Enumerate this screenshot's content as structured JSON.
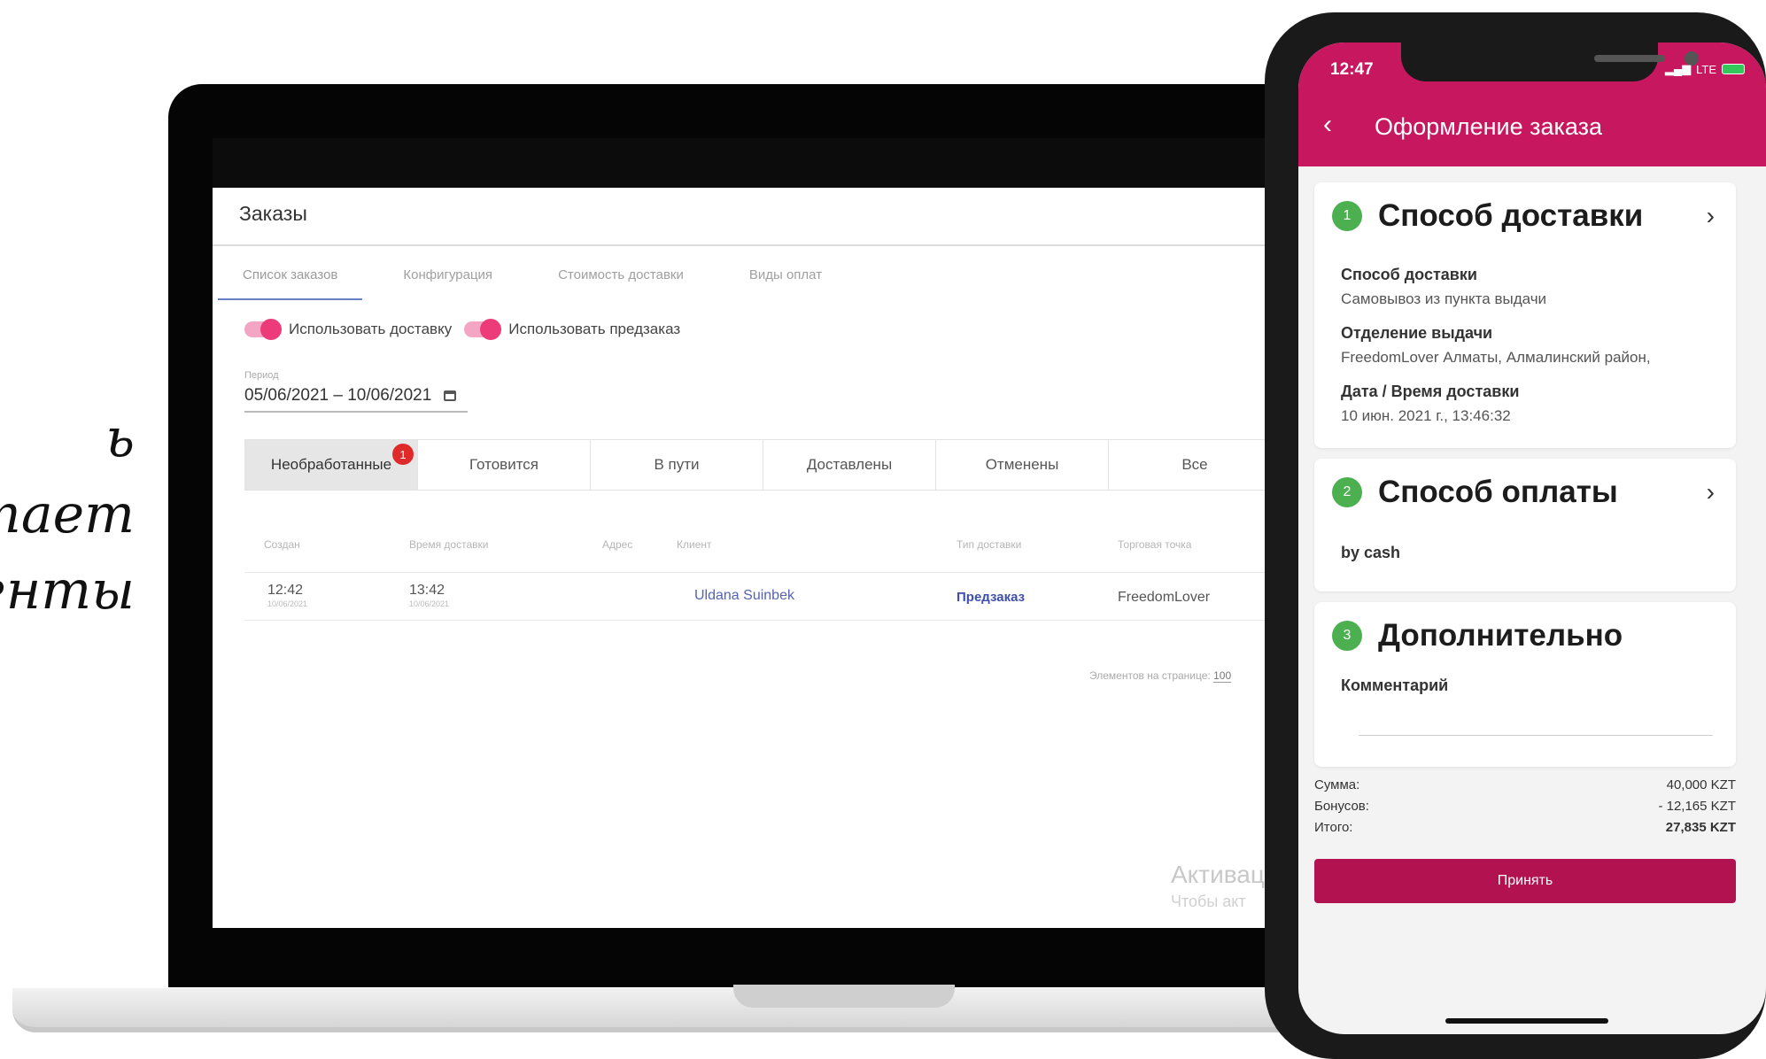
{
  "left_text": [
    "ь",
    "отает",
    "енты"
  ],
  "admin": {
    "title": "Заказы",
    "tabs": [
      "Список заказов",
      "Конфигурация",
      "Стоимость доставки",
      "Виды оплат"
    ],
    "toggles": [
      "Использовать доставку",
      "Использовать предзаказ"
    ],
    "period_label": "Период",
    "period_value": "05/06/2021 – 10/06/2021",
    "statuses": [
      "Необработанные",
      "Готовится",
      "В пути",
      "Доставлены",
      "Отменены",
      "Все"
    ],
    "badge_count": "1",
    "columns": [
      "Создан",
      "Время доставки",
      "Адрес",
      "Клиент",
      "Тип доставки",
      "Торговая точка"
    ],
    "row": {
      "created_time": "12:42",
      "created_date": "10/06/2021",
      "delivery_time": "13:42",
      "delivery_date": "10/06/2021",
      "client": "Uldana Suinbek",
      "delivery_type": "Предзаказ",
      "store": "FreedomLover"
    },
    "per_page_label": "Элементов на странице:",
    "per_page_value": "100",
    "watermark_title": "Активац",
    "watermark_sub": "Чтобы акт"
  },
  "phone": {
    "time": "12:47",
    "network": "LTE",
    "header_title": "Оформление заказа",
    "sections": [
      {
        "num": "1",
        "title": "Способ доставки"
      },
      {
        "num": "2",
        "title": "Способ оплаты"
      },
      {
        "num": "3",
        "title": "Дополнительно"
      }
    ],
    "delivery": {
      "method_label": "Способ доставки",
      "method_value": "Самовывоз из пункта выдачи",
      "branch_label": "Отделение выдачи",
      "branch_value": "FreedomLover Алматы, Алмалинский район,",
      "datetime_label": "Дата / Время доставки",
      "datetime_value": "10 июн. 2021 г., 13:46:32"
    },
    "payment_value": "by cash",
    "comment_label": "Комментарий",
    "sum_label": "Сумма:",
    "sum_value": "40,000 KZT",
    "bonus_label": "Бонусов:",
    "bonus_value": "- 12,165 KZT",
    "total_label": "Итого:",
    "total_value": "27,835 KZT",
    "accept_label": "Принять"
  },
  "colors": {
    "brand": "#c7175f",
    "button": "#b2124f",
    "toggle": "#ec3b78",
    "step": "#4caf50",
    "badge": "#e02a2a"
  }
}
